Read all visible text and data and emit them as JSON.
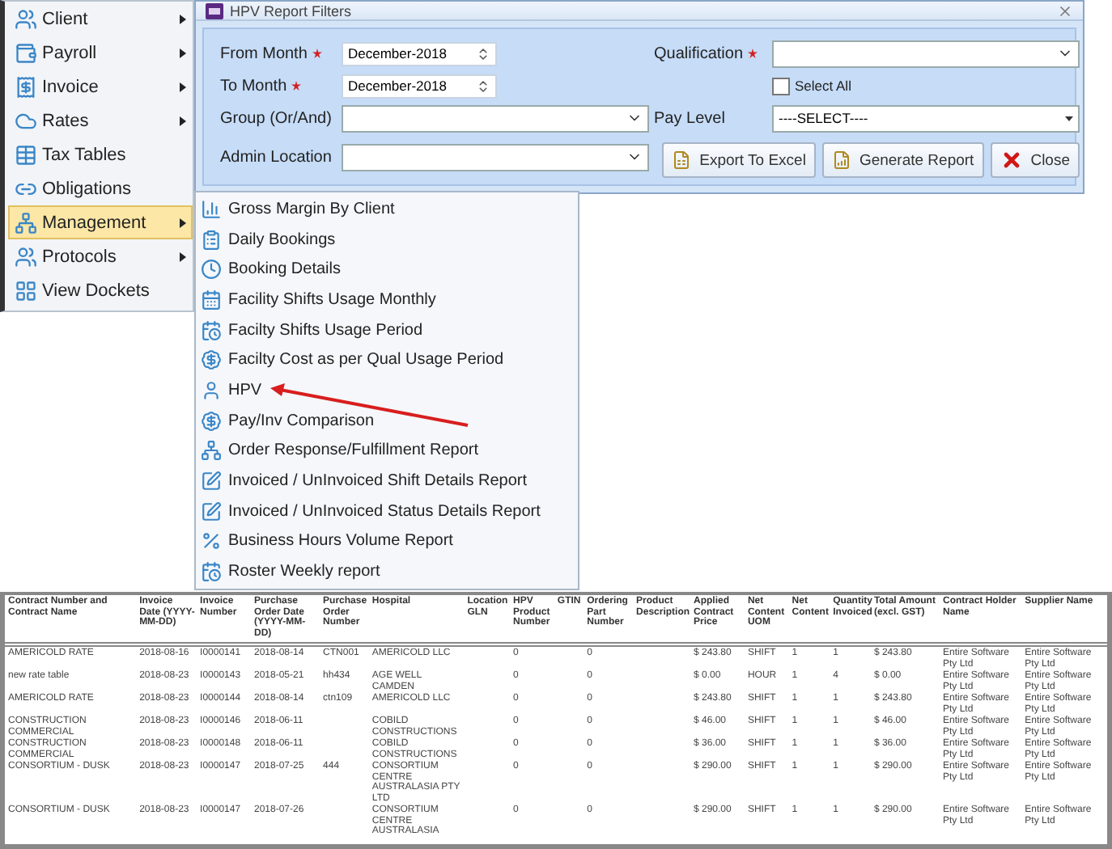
{
  "main_menu": [
    {
      "label": "Client",
      "has_submenu": true,
      "selected": false
    },
    {
      "label": "Payroll",
      "has_submenu": true,
      "selected": false
    },
    {
      "label": "Invoice",
      "has_submenu": true,
      "selected": false
    },
    {
      "label": "Rates",
      "has_submenu": true,
      "selected": false
    },
    {
      "label": "Tax Tables",
      "has_submenu": false,
      "selected": false
    },
    {
      "label": "Obligations",
      "has_submenu": false,
      "selected": false
    },
    {
      "label": "Management",
      "has_submenu": true,
      "selected": true
    },
    {
      "label": "Protocols",
      "has_submenu": true,
      "selected": false
    },
    {
      "label": "View Dockets",
      "has_submenu": false,
      "selected": false
    }
  ],
  "dialog": {
    "title": "HPV Report Filters",
    "from_month": {
      "label": "From Month",
      "required": true,
      "value": "December-2018"
    },
    "to_month": {
      "label": "To Month",
      "required": true,
      "value": "December-2018"
    },
    "group": {
      "label": "Group (Or/And)",
      "required": false
    },
    "admin_location": {
      "label": "Admin Location",
      "required": false
    },
    "qualification": {
      "label": "Qualification",
      "required": true
    },
    "select_all": {
      "label": "Select All",
      "checked": false
    },
    "pay_level": {
      "label": "Pay Level",
      "required": false,
      "value": "----SELECT----"
    },
    "buttons": [
      {
        "label": "Export To Excel",
        "kind": "excel"
      },
      {
        "label": "Generate Report",
        "kind": "report"
      },
      {
        "label": "Close",
        "kind": "close"
      }
    ]
  },
  "submenu": [
    {
      "label": "Gross Margin By Client"
    },
    {
      "label": "Daily Bookings"
    },
    {
      "label": "Booking Details"
    },
    {
      "label": "Facility Shifts Usage Monthly"
    },
    {
      "label": "Facilty Shifts Usage Period"
    },
    {
      "label": "Facilty Cost as per Qual Usage Period"
    },
    {
      "label": "HPV"
    },
    {
      "label": "Pay/Inv Comparison"
    },
    {
      "label": "Order Response/Fulfillment Report"
    },
    {
      "label": "Invoiced / UnInvoiced Shift Details Report"
    },
    {
      "label": "Invoiced / UnInvoiced Status Details Report"
    },
    {
      "label": "Business Hours Volume Report"
    },
    {
      "label": "Roster Weekly report"
    }
  ],
  "report": {
    "columns": [
      "Contract Number and Contract Name",
      "Invoice Date (YYYY-MM-DD)",
      "Invoice Number",
      "Purchase Order Date (YYYY-MM-DD)",
      "Purchase Order Number",
      "Hospital",
      "Location GLN",
      "HPV Product Number",
      "GTIN",
      "Ordering Part Number",
      "Product Description",
      "Applied Contract Price",
      "Net Content UOM",
      "Net Content",
      "Quantity Invoiced",
      "Total Amount (excl. GST)",
      "Contract Holder Name",
      "Supplier Name"
    ],
    "rows": [
      [
        "AMERICOLD RATE",
        "2018-08-16",
        "I0000141",
        "2018-08-14",
        "CTN001",
        "AMERICOLD LLC",
        null,
        "0",
        null,
        "0",
        null,
        "$ 243.80",
        "SHIFT",
        "1",
        "1",
        "$ 243.80",
        "Entire Software Pty Ltd",
        "Entire Software Pty Ltd"
      ],
      [
        "new rate table",
        "2018-08-23",
        "I0000143",
        "2018-05-21",
        "hh434",
        "AGE WELL CAMDEN",
        null,
        "0",
        null,
        "0",
        null,
        "$ 0.00",
        "HOUR",
        "1",
        "4",
        "$ 0.00",
        "Entire Software Pty Ltd",
        "Entire Software Pty Ltd"
      ],
      [
        "AMERICOLD RATE",
        "2018-08-23",
        "I0000144",
        "2018-08-14",
        "ctn109",
        "AMERICOLD LLC",
        null,
        "0",
        null,
        "0",
        null,
        "$ 243.80",
        "SHIFT",
        "1",
        "1",
        "$ 243.80",
        "Entire Software Pty Ltd",
        "Entire Software Pty Ltd"
      ],
      [
        "CONSTRUCTION COMMERCIAL",
        "2018-08-23",
        "I0000146",
        "2018-06-11",
        null,
        "COBILD CONSTRUCTIONS",
        null,
        "0",
        null,
        "0",
        null,
        "$ 46.00",
        "SHIFT",
        "1",
        "1",
        "$ 46.00",
        "Entire Software Pty Ltd",
        "Entire Software Pty Ltd"
      ],
      [
        "CONSTRUCTION COMMERCIAL",
        "2018-08-23",
        "I0000148",
        "2018-06-11",
        null,
        "COBILD CONSTRUCTIONS",
        null,
        "0",
        null,
        "0",
        null,
        "$ 36.00",
        "SHIFT",
        "1",
        "1",
        "$ 36.00",
        "Entire Software Pty Ltd",
        "Entire Software Pty Ltd"
      ],
      [
        "CONSORTIUM - DUSK",
        "2018-08-23",
        "I0000147",
        "2018-07-25",
        "444",
        "CONSORTIUM CENTRE AUSTRALASIA PTY LTD",
        null,
        "0",
        null,
        "0",
        null,
        "$ 290.00",
        "SHIFT",
        "1",
        "1",
        "$ 290.00",
        "Entire Software Pty Ltd",
        "Entire Software Pty Ltd"
      ],
      [
        "CONSORTIUM - DUSK",
        "2018-08-23",
        "I0000147",
        "2018-07-26",
        null,
        "CONSORTIUM CENTRE AUSTRALASIA",
        null,
        "0",
        null,
        "0",
        null,
        "$ 290.00",
        "SHIFT",
        "1",
        "1",
        "$ 290.00",
        "Entire Software Pty Ltd",
        "Entire Software Pty Ltd"
      ]
    ]
  }
}
